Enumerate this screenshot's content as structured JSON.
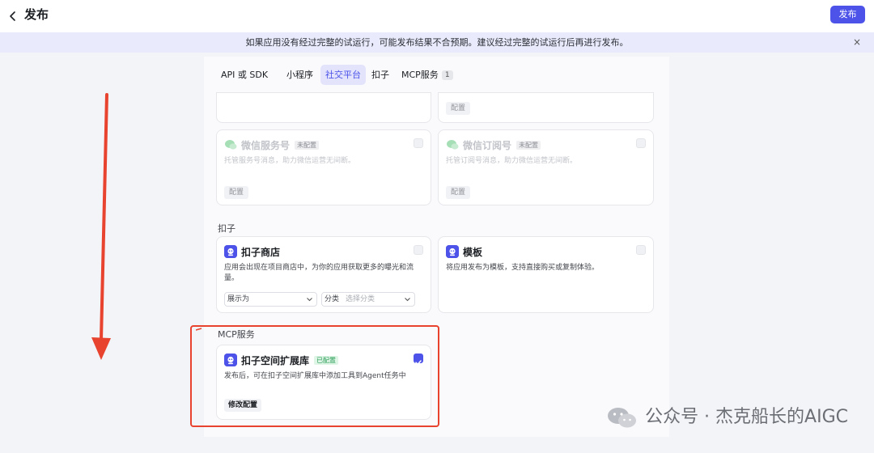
{
  "header": {
    "back_icon": "chevron-left-icon",
    "title": "发布",
    "publish_label": "发布"
  },
  "warning": {
    "text": "如果应用没有经过完整的试运行，可能发布结果不合预期。建议经过完整的试运行后再进行发布。",
    "close_icon": "close-icon",
    "close_glyph": "×"
  },
  "tabs": [
    {
      "label": "API 或 SDK",
      "active": false
    },
    {
      "label": "小程序",
      "active": false
    },
    {
      "label": "社交平台",
      "active": true
    },
    {
      "label": "扣子",
      "active": false
    },
    {
      "label": "MCP服务",
      "badge": "1",
      "active": false
    }
  ],
  "social": {
    "partial_card_button": "配置",
    "wechat_service": {
      "title": "微信服务号",
      "tag": "未配置",
      "desc": "托管服务号消息，助力微信运营无间断。",
      "button": "配置"
    },
    "wechat_subscription": {
      "title": "微信订阅号",
      "tag": "未配置",
      "desc": "托管订阅号消息，助力微信运营无间断。",
      "button": "配置"
    }
  },
  "kouzi": {
    "section_label": "扣子",
    "store": {
      "title": "扣子商店",
      "desc": "应用会出现在项目商店中，为你的应用获取更多的曝光和流量。",
      "display_select": "展示为",
      "category_label": "分类",
      "category_placeholder": "选择分类"
    },
    "template": {
      "title": "模板",
      "desc": "将应用发布为模板，支持直接购买或复制体验。"
    }
  },
  "mcp": {
    "section_label": "MCP服务",
    "card": {
      "title": "扣子空间扩展库",
      "tag": "已配置",
      "desc": "发布后，可在扣子空间扩展库中添加工具到Agent任务中",
      "button": "修改配置",
      "checked": true
    }
  },
  "annotations": {
    "arrow_color": "#e8432f",
    "box_color": "#e8432f"
  },
  "watermark": {
    "text": "公众号 · 杰克船长的AIGC",
    "icon": "wechat-icon"
  },
  "colors": {
    "accent": "#4d53e8",
    "banner_bg": "#e9ebfc",
    "configured_green": "#2e9e5a"
  }
}
